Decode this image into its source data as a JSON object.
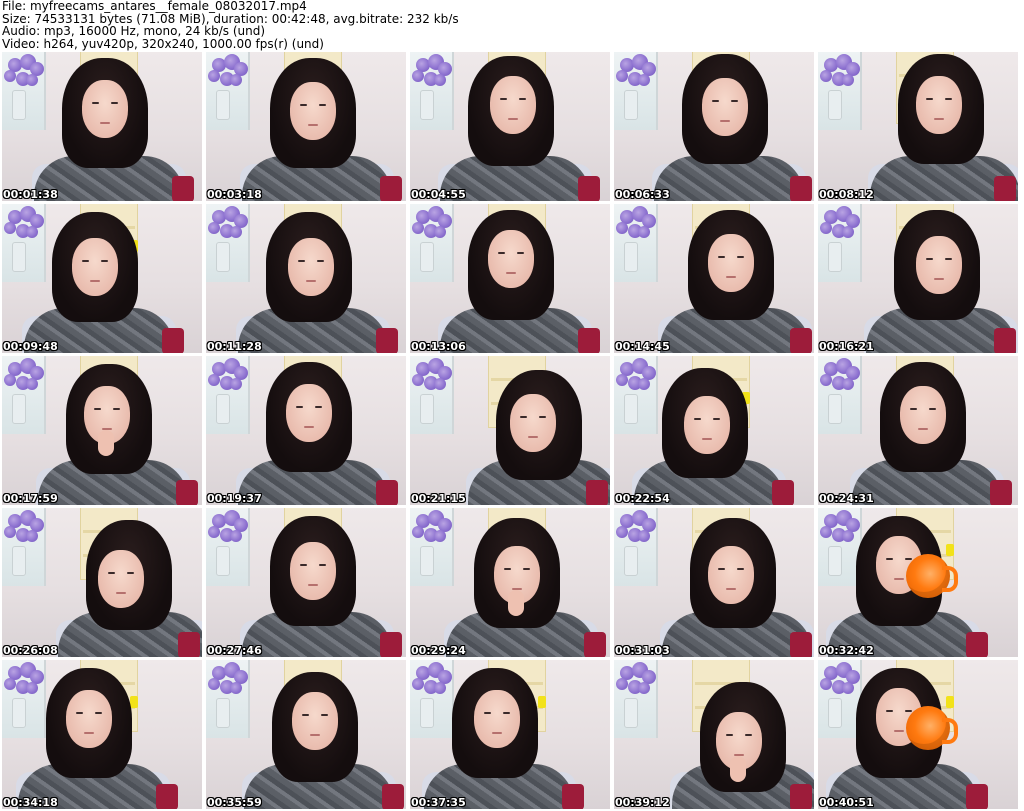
{
  "header": {
    "file": "File: myfreecams_antares__female_08032017.mp4",
    "size": "Size: 74533131 bytes (71.08 MiB), duration: 00:42:48, avg.bitrate: 232 kb/s",
    "audio": "Audio: mp3, 16000 Hz, mono, 24 kb/s (und)",
    "video": "Video: h264, yuv420p, 320x240, 1000.00 fps(r) (und)"
  },
  "thumbnails": [
    {
      "timestamp": "00:01:38"
    },
    {
      "timestamp": "00:03:18"
    },
    {
      "timestamp": "00:04:55"
    },
    {
      "timestamp": "00:06:33"
    },
    {
      "timestamp": "00:08:12"
    },
    {
      "timestamp": "00:09:48"
    },
    {
      "timestamp": "00:11:28"
    },
    {
      "timestamp": "00:13:06"
    },
    {
      "timestamp": "00:14:45"
    },
    {
      "timestamp": "00:16:21"
    },
    {
      "timestamp": "00:17:59"
    },
    {
      "timestamp": "00:19:37"
    },
    {
      "timestamp": "00:21:15"
    },
    {
      "timestamp": "00:22:54"
    },
    {
      "timestamp": "00:24:31"
    },
    {
      "timestamp": "00:26:08"
    },
    {
      "timestamp": "00:27:46"
    },
    {
      "timestamp": "00:29:24"
    },
    {
      "timestamp": "00:31:03"
    },
    {
      "timestamp": "00:32:42"
    },
    {
      "timestamp": "00:34:18"
    },
    {
      "timestamp": "00:35:59"
    },
    {
      "timestamp": "00:37:35"
    },
    {
      "timestamp": "00:39:12"
    },
    {
      "timestamp": "00:40:51"
    }
  ],
  "colors": {
    "timestamp_text": "#ffffff",
    "timestamp_outline": "#000000",
    "cup": "#ff7a10",
    "hair": "#140d0e",
    "background": "#ffffff"
  }
}
